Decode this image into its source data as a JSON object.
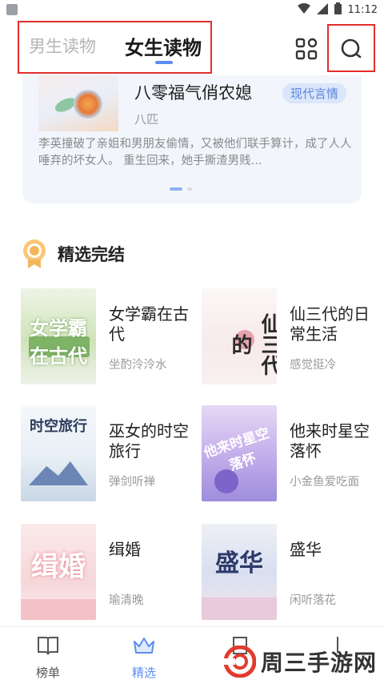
{
  "status_bar": {
    "time": "11:12"
  },
  "header": {
    "tabs": [
      {
        "label": "男生读物",
        "active": false
      },
      {
        "label": "女生读物",
        "active": true
      }
    ]
  },
  "featured": {
    "title": "八零福气俏农媳",
    "genre": "现代言情",
    "author": "八匹",
    "description": "李英撞破了亲姐和男朋友偷情，又被他们联手算计，成了人人唾弃的坏女人。 重生回来，她手撕渣男贱..."
  },
  "section": {
    "title": "精选完结"
  },
  "books": [
    {
      "title": "女学霸在古代",
      "author": "坐酌泠泠水",
      "cover_text": "女学霸在古代"
    },
    {
      "title": "仙三代的日常生活",
      "author": "感觉挺冷",
      "cover_text": "仙三代的"
    },
    {
      "title": "巫女的时空旅行",
      "author": "弹剑听禅",
      "cover_text": "时空旅行"
    },
    {
      "title": "他来时星空落怀",
      "author": "小金鱼爱吃面",
      "cover_text": "他来时星空落怀"
    },
    {
      "title": "缉婚",
      "author": "瑜清晚",
      "cover_text": "缉婚"
    },
    {
      "title": "盛华",
      "author": "闲听落花",
      "cover_text": "盛华"
    }
  ],
  "bottom_nav": [
    {
      "label": "榜单",
      "icon": "book-icon",
      "active": false
    },
    {
      "label": "精选",
      "icon": "crown-icon",
      "active": true
    }
  ],
  "watermark": {
    "text": "周三手游网"
  },
  "colors": {
    "accent": "#5b8ef0",
    "highlight_box": "#e32e2e"
  }
}
